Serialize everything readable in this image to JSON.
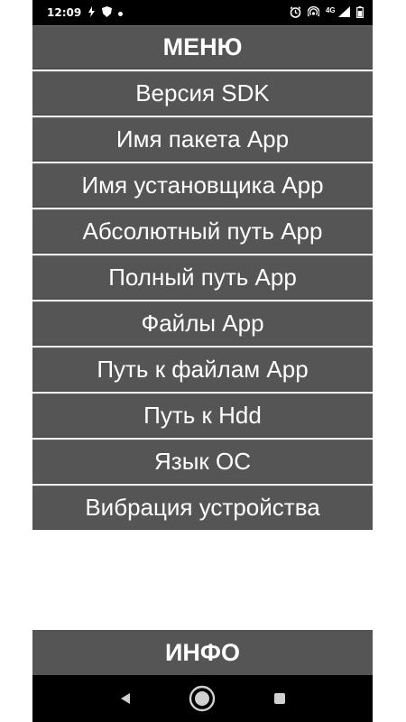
{
  "status_bar": {
    "time": "12:09",
    "left_icons": [
      "flash-icon",
      "shield-icon",
      "dot-icon"
    ],
    "network_label": "4G",
    "right_icons": [
      "alarm-icon",
      "hotspot-icon",
      "signal-icon",
      "battery-icon"
    ]
  },
  "menu": {
    "title": "МЕНЮ",
    "items": [
      {
        "label": "Версия SDK"
      },
      {
        "label": "Имя пакета App"
      },
      {
        "label": "Имя установщика App"
      },
      {
        "label": "Абсолютный путь App"
      },
      {
        "label": "Полный путь App"
      },
      {
        "label": "Файлы App"
      },
      {
        "label": "Путь к файлам App"
      },
      {
        "label": "Путь к Hdd"
      },
      {
        "label": "Язык ОС"
      },
      {
        "label": "Вибрация устройства"
      }
    ]
  },
  "info": {
    "label": "ИНФО"
  },
  "nav_bar": {
    "buttons": [
      "back-icon",
      "home-icon",
      "recents-icon"
    ]
  },
  "colors": {
    "row_bg": "#555555",
    "status_bg": "#000000",
    "text": "#ffffff"
  }
}
